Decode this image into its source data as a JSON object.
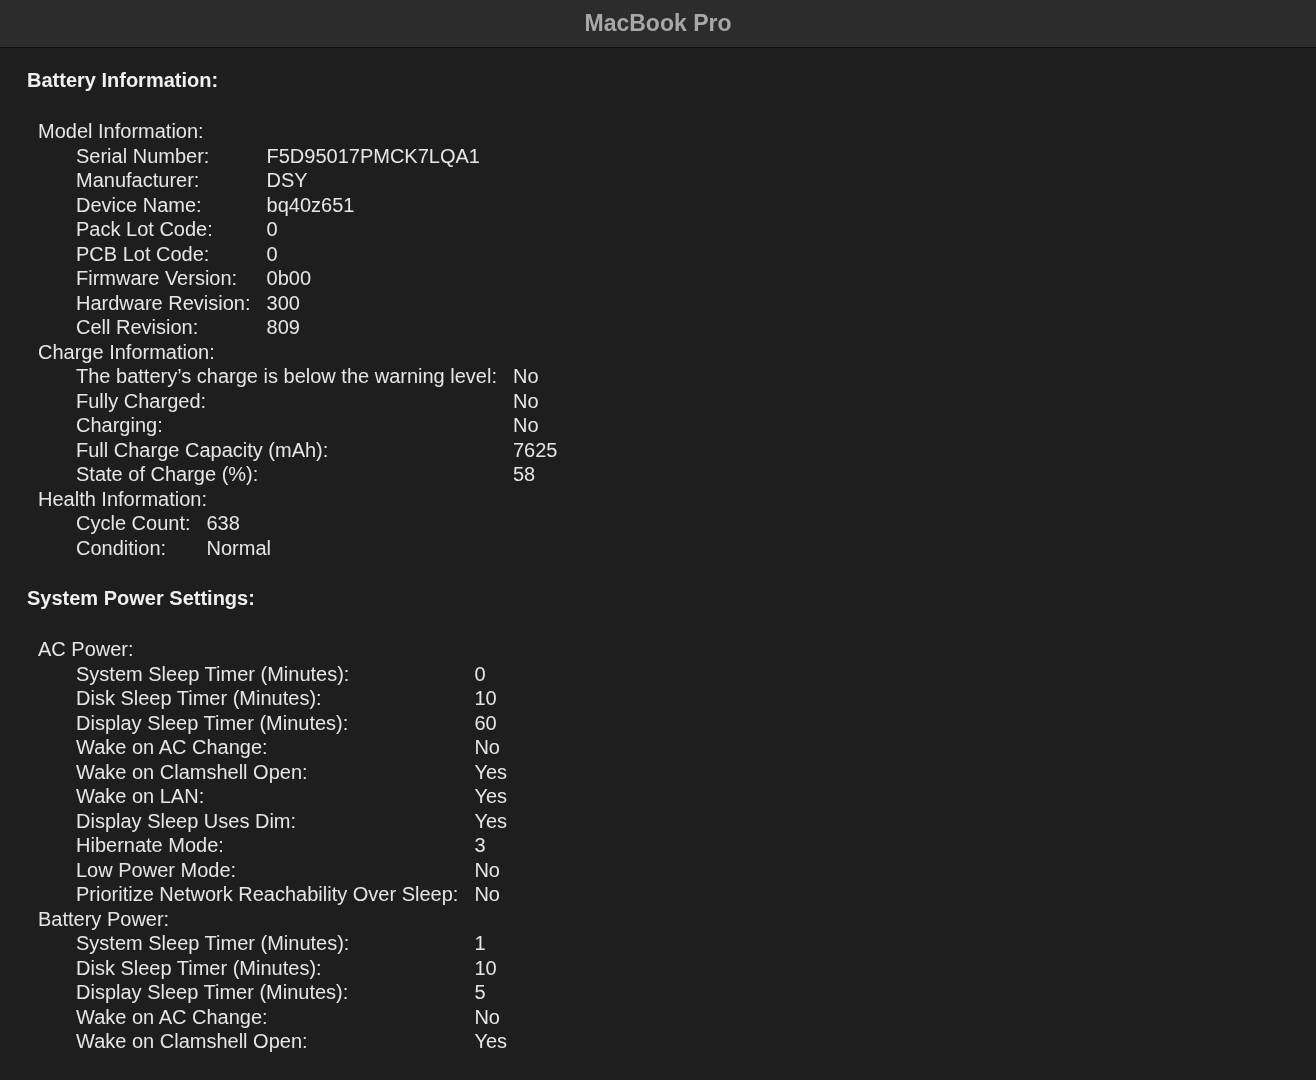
{
  "window": {
    "title": "MacBook Pro"
  },
  "sections": [
    {
      "title": "Battery Information:",
      "kind": "per_group",
      "groups": [
        {
          "label": "Model Information:",
          "items": [
            {
              "label": "Serial Number:",
              "value": "F5D95017PMCK7LQA1"
            },
            {
              "label": "Manufacturer:",
              "value": "DSY"
            },
            {
              "label": "Device Name:",
              "value": "bq40z651"
            },
            {
              "label": "Pack Lot Code:",
              "value": "0"
            },
            {
              "label": "PCB Lot Code:",
              "value": "0"
            },
            {
              "label": "Firmware Version:",
              "value": "0b00"
            },
            {
              "label": "Hardware Revision:",
              "value": "300"
            },
            {
              "label": "Cell Revision:",
              "value": "809"
            }
          ]
        },
        {
          "label": "Charge Information:",
          "items": [
            {
              "label": "The battery’s charge is below the warning level:",
              "value": "No"
            },
            {
              "label": "Fully Charged:",
              "value": "No"
            },
            {
              "label": "Charging:",
              "value": "No"
            },
            {
              "label": "Full Charge Capacity (mAh):",
              "value": "7625"
            },
            {
              "label": "State of Charge (%):",
              "value": "58"
            }
          ]
        },
        {
          "label": "Health Information:",
          "items": [
            {
              "label": "Cycle Count:",
              "value": "638"
            },
            {
              "label": "Condition:",
              "value": "Normal"
            }
          ]
        }
      ]
    },
    {
      "title": "System Power Settings:",
      "kind": "shared",
      "groups": [
        {
          "label": "AC Power:",
          "items": [
            {
              "label": "System Sleep Timer (Minutes):",
              "value": "0"
            },
            {
              "label": "Disk Sleep Timer (Minutes):",
              "value": "10"
            },
            {
              "label": "Display Sleep Timer (Minutes):",
              "value": "60"
            },
            {
              "label": "Wake on AC Change:",
              "value": "No"
            },
            {
              "label": "Wake on Clamshell Open:",
              "value": "Yes"
            },
            {
              "label": "Wake on LAN:",
              "value": "Yes"
            },
            {
              "label": "Display Sleep Uses Dim:",
              "value": "Yes"
            },
            {
              "label": "Hibernate Mode:",
              "value": "3"
            },
            {
              "label": "Low Power Mode:",
              "value": "No"
            },
            {
              "label": "Prioritize Network Reachability Over Sleep:",
              "value": "No"
            }
          ]
        },
        {
          "label": "Battery Power:",
          "items": [
            {
              "label": "System Sleep Timer (Minutes):",
              "value": "1"
            },
            {
              "label": "Disk Sleep Timer (Minutes):",
              "value": "10"
            },
            {
              "label": "Display Sleep Timer (Minutes):",
              "value": "5"
            },
            {
              "label": "Wake on AC Change:",
              "value": "No"
            },
            {
              "label": "Wake on Clamshell Open:",
              "value": "Yes"
            }
          ]
        }
      ]
    }
  ]
}
